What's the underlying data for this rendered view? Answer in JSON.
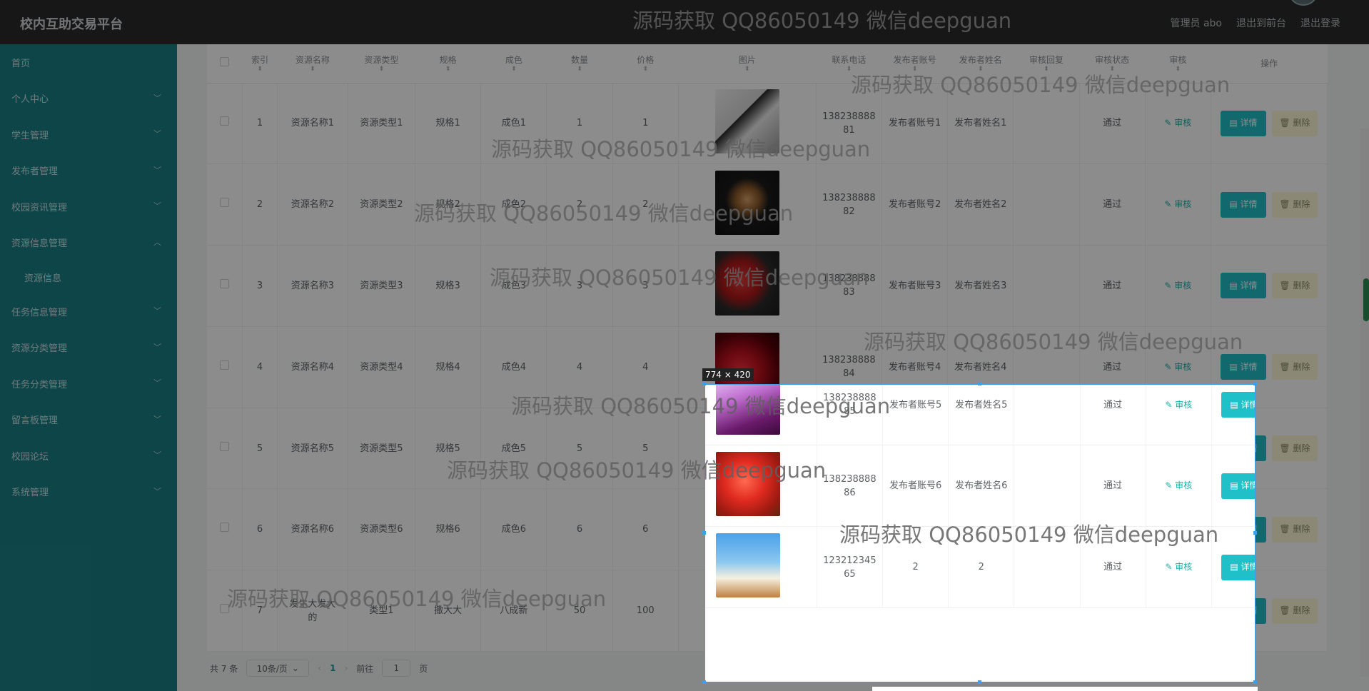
{
  "header": {
    "title": "校内互助交易平台",
    "links": [
      "管理员 abo",
      "退出到前台",
      "退出登录"
    ]
  },
  "sidebar": {
    "items": [
      {
        "label": "首页",
        "chevron": false
      },
      {
        "label": "个人中心",
        "chevron": true
      },
      {
        "label": "学生管理",
        "chevron": true
      },
      {
        "label": "发布者管理",
        "chevron": true
      },
      {
        "label": "校园资讯管理",
        "chevron": true
      },
      {
        "label": "资源信息管理",
        "chevron": true,
        "expanded": true
      },
      {
        "label": "资源信息",
        "sub": true
      },
      {
        "label": "任务信息管理",
        "chevron": true
      },
      {
        "label": "资源分类管理",
        "chevron": true
      },
      {
        "label": "任务分类管理",
        "chevron": true
      },
      {
        "label": "留言板管理",
        "chevron": true
      },
      {
        "label": "校园论坛",
        "chevron": true
      },
      {
        "label": "系统管理",
        "chevron": true
      }
    ]
  },
  "table": {
    "columns": [
      "",
      "索引",
      "资源名称",
      "资源类型",
      "规格",
      "成色",
      "数量",
      "价格",
      "图片",
      "联系电话",
      "发布者账号",
      "发布者姓名",
      "审核回复",
      "审核状态",
      "审核",
      "操作"
    ],
    "rows": [
      {
        "idx": "1",
        "name": "资源名称1",
        "type": "资源类型1",
        "spec": "规格1",
        "cond": "成色1",
        "qty": "1",
        "price": "1",
        "phone": "13823888881",
        "acct": "发布者账号1",
        "pname": "发布者姓名1",
        "reply": "",
        "status": "通过",
        "img": "book"
      },
      {
        "idx": "2",
        "name": "资源名称2",
        "type": "资源类型2",
        "spec": "规格2",
        "cond": "成色2",
        "qty": "2",
        "price": "2",
        "phone": "13823888882",
        "acct": "发布者账号2",
        "pname": "发布者姓名2",
        "reply": "",
        "status": "通过",
        "img": "watch"
      },
      {
        "idx": "3",
        "name": "资源名称3",
        "type": "资源类型3",
        "spec": "规格3",
        "cond": "成色3",
        "qty": "3",
        "price": "3",
        "phone": "13823888883",
        "acct": "发布者账号3",
        "pname": "发布者姓名3",
        "reply": "",
        "status": "通过",
        "img": "shoes"
      },
      {
        "idx": "4",
        "name": "资源名称4",
        "type": "资源类型4",
        "spec": "规格4",
        "cond": "成色4",
        "qty": "4",
        "price": "4",
        "phone": "13823888884",
        "acct": "发布者账号4",
        "pname": "发布者姓名4",
        "reply": "",
        "status": "通过",
        "img": "red"
      },
      {
        "idx": "5",
        "name": "资源名称5",
        "type": "资源类型5",
        "spec": "规格5",
        "cond": "成色5",
        "qty": "5",
        "price": "5",
        "phone": "13823888885",
        "acct": "发布者账号5",
        "pname": "发布者姓名5",
        "reply": "",
        "status": "通过",
        "img": "perfume"
      },
      {
        "idx": "6",
        "name": "资源名称6",
        "type": "资源类型6",
        "spec": "规格6",
        "cond": "成色6",
        "qty": "6",
        "price": "6",
        "phone": "13823888886",
        "acct": "发布者账号6",
        "pname": "发布者姓名6",
        "reply": "",
        "status": "通过",
        "img": "fruit"
      },
      {
        "idx": "7",
        "name": "发生大发大的",
        "type": "类型1",
        "spec": "撒大大",
        "cond": "八成新",
        "qty": "50",
        "price": "100",
        "phone": "12321234565",
        "acct": "2",
        "pname": "2",
        "reply": "",
        "status": "通过",
        "img": "sky"
      }
    ],
    "audit_label": "审核",
    "detail_label": "详情",
    "delete_label": "删除"
  },
  "pager": {
    "total": "共 7 条",
    "page_size": "10条/页",
    "current": "1",
    "goto_prefix": "前往",
    "goto_value": "1",
    "goto_suffix": "页"
  },
  "capture": {
    "size_label": "774 × 420"
  },
  "watermark": "源码获取 QQ86050149 微信deepguan"
}
